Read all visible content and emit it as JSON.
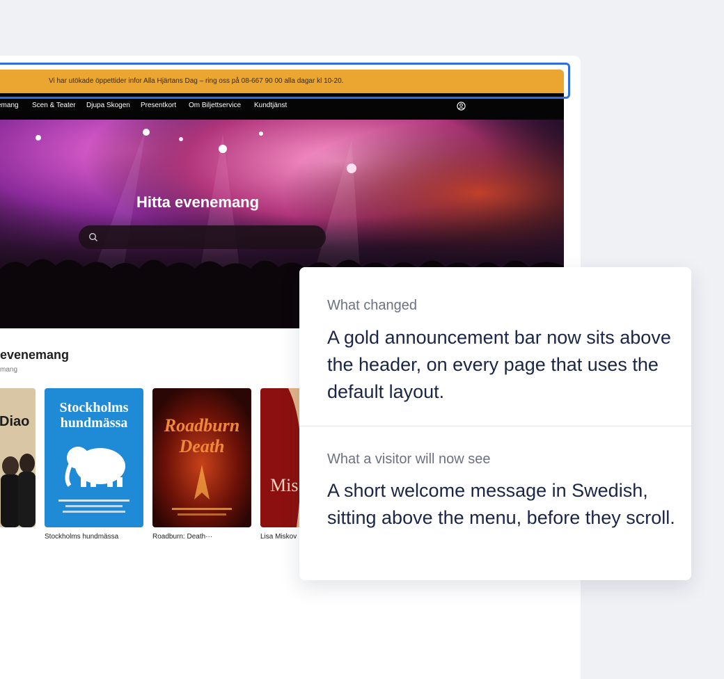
{
  "announcement": {
    "text": "Vi har utökade öppettider infor Alla Hjärtans Dag – ring oss på 08-667 90 00 alla dagar kl 10-20."
  },
  "nav": {
    "items": [
      "emang",
      "Scen & Teater",
      "Djupa Skogen",
      "Presentkort",
      "Om Biljettservice",
      "Kundtjänst"
    ],
    "user_icon": "user-circle-icon"
  },
  "hero": {
    "title": "Hitta evenemang",
    "search_icon": "search-icon"
  },
  "section": {
    "title": "evenemang",
    "subtitle": "mang"
  },
  "cards": [
    {
      "poster_text": "Diao",
      "label": ""
    },
    {
      "poster_text": "Stockholms hundmässa",
      "label": "Stockholms hundmässa"
    },
    {
      "poster_text": "Roadburn Death",
      "label": "Roadburn: Death···"
    },
    {
      "poster_text": "Mis",
      "label": "Lisa Miskov"
    }
  ],
  "panel": {
    "changed_label": "What changed",
    "changed_text": "A gold announcement bar now sits above the header, on every page that uses the default layout.",
    "visitor_label": "What a visitor will now see",
    "visitor_text": "A short welcome message in Swedish, sitting above the menu, before they scroll."
  },
  "colors": {
    "announcement_bg": "#eba531",
    "highlight": "#2f6fe0",
    "nav_bg": "#050505",
    "panel_text": "#1b2647"
  }
}
